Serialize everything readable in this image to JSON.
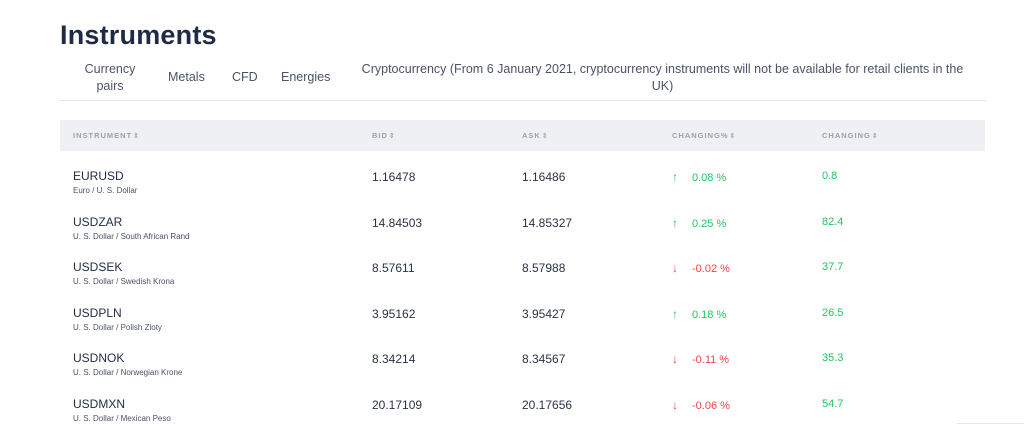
{
  "title": "Instruments",
  "tabs": {
    "currency": "Currency pairs",
    "metals": "Metals",
    "cfd": "CFD",
    "energies": "Energies",
    "crypto": "Cryptocurrency (From 6 January 2021, cryptocurrency instruments will not be available for retail clients in the UK)"
  },
  "table": {
    "headers": {
      "instrument": "INSTRUMENT",
      "bid": "BID",
      "ask": "ASK",
      "changing_pct": "CHANGING%",
      "changing": "CHANGING",
      "sort_glyph": "⇕"
    },
    "rows": [
      {
        "symbol": "EURUSD",
        "name": "Euro / U. S. Dollar",
        "bid": "1.16478",
        "ask": "1.16486",
        "direction": "up",
        "arrow": "↑",
        "changing_pct": "0.08 %",
        "changing": "0.8"
      },
      {
        "symbol": "USDZAR",
        "name": "U. S. Dollar / South African Rand",
        "bid": "14.84503",
        "ask": "14.85327",
        "direction": "up",
        "arrow": "↑",
        "changing_pct": "0.25 %",
        "changing": "82.4"
      },
      {
        "symbol": "USDSEK",
        "name": "U. S. Dollar / Swedish Krona",
        "bid": "8.57611",
        "ask": "8.57988",
        "direction": "down",
        "arrow": "↓",
        "changing_pct": "-0.02 %",
        "changing": "37.7"
      },
      {
        "symbol": "USDPLN",
        "name": "U. S. Dollar / Polish Zloty",
        "bid": "3.95162",
        "ask": "3.95427",
        "direction": "up",
        "arrow": "↑",
        "changing_pct": "0.18 %",
        "changing": "26.5"
      },
      {
        "symbol": "USDNOK",
        "name": "U. S. Dollar / Norwegian Krone",
        "bid": "8.34214",
        "ask": "8.34567",
        "direction": "down",
        "arrow": "↓",
        "changing_pct": "-0.11 %",
        "changing": "35.3"
      },
      {
        "symbol": "USDMXN",
        "name": "U. S. Dollar / Mexican Peso",
        "bid": "20.17109",
        "ask": "20.17656",
        "direction": "down",
        "arrow": "↓",
        "changing_pct": "-0.06 %",
        "changing": "54.7"
      }
    ]
  },
  "colors": {
    "up": "#22c55e",
    "down": "#ef4444",
    "header_bg": "#eef0f3",
    "title": "#1f2a44"
  }
}
